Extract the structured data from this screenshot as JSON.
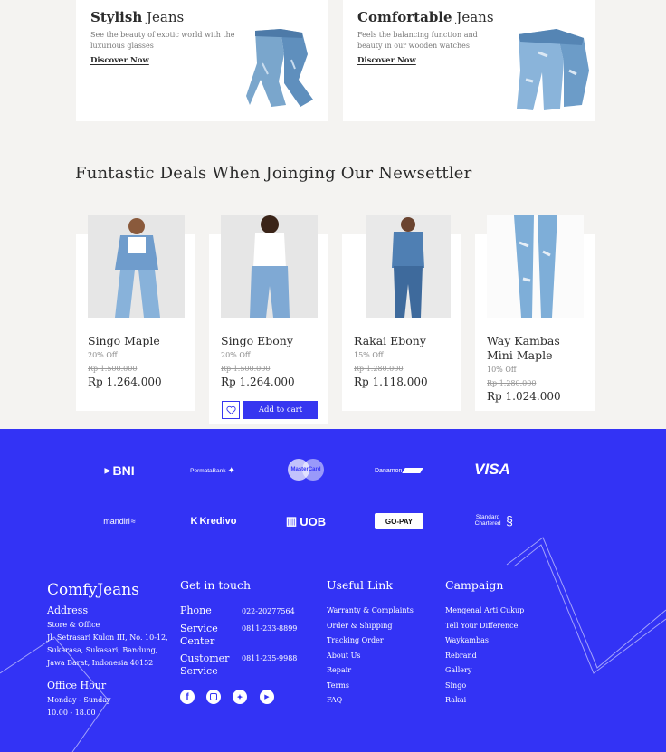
{
  "promos": [
    {
      "title_bold": "Stylish",
      "title_rest": " Jeans",
      "desc": "See the beauty of exotic world with the luxurious glasses",
      "link": "Discover Now"
    },
    {
      "title_bold": "Comfortable",
      "title_rest": " Jeans",
      "desc": "Feels the balancing function and beauty in our wooden watches",
      "link": "Discover Now"
    }
  ],
  "deals": {
    "title": "Funtastic Deals When Joinging Our Newsettler",
    "add_to_cart": "Add to cart",
    "products": [
      {
        "name": "Singo Maple",
        "off": "20% Off",
        "old": "Rp 1.500.000",
        "price": "Rp 1.264.000"
      },
      {
        "name": "Singo Ebony",
        "off": "20% Off",
        "old": "Rp 1.500.000",
        "price": "Rp 1.264.000"
      },
      {
        "name": "Rakai Ebony",
        "off": "15% Off",
        "old": "Rp 1.280.000",
        "price": "Rp 1.118.000"
      },
      {
        "name": "Way Kambas Mini Maple",
        "off": "10% Off",
        "old": "Rp 1.280.000",
        "price": "Rp 1.024.000"
      }
    ]
  },
  "payments": {
    "row1": [
      "BNI",
      "PermataBank",
      "MasterCard",
      "Danamon",
      "VISA"
    ],
    "row2": [
      "mandiri",
      "Kredivo",
      "UOB",
      "GO-PAY",
      "Standard Chartered"
    ]
  },
  "footer": {
    "brand": "ComfyJeans",
    "address_title": "Address",
    "address_lines": [
      "Store & Office",
      "Jl. Setrasari Kulon III, No. 10-12,",
      "Sukarasa, Sukasari, Bandung,",
      "Jawa Barat, Indonesia 40152"
    ],
    "hours_title": "Office Hour",
    "hours_lines": [
      "Monday - Sunday",
      "10.00 - 18.00"
    ],
    "contact_title": "Get in touch",
    "contacts": [
      {
        "label": "Phone",
        "value": "022-20277564"
      },
      {
        "label": "Service Center",
        "value": "0811-233-8899"
      },
      {
        "label": "Customer Service",
        "value": "0811-235-9988"
      }
    ],
    "useful_title": "Useful Link",
    "useful_links": [
      "Warranty & Complaints",
      "Order & Shipping",
      "Tracking Order",
      "About Us",
      "Repair",
      "Terms",
      "FAQ"
    ],
    "campaign_title": "Campaign",
    "campaign_links": [
      "Mengenal Arti Cukup",
      "Tell Your Difference",
      "Waykambas",
      "Rebrand",
      "Gallery",
      "Singo",
      "Rakai"
    ],
    "social_icons": [
      "facebook-icon",
      "instagram-icon",
      "twitter-icon",
      "youtube-icon"
    ]
  },
  "colors": {
    "accent": "#3636f0",
    "footer_bg": "#3333f5"
  }
}
